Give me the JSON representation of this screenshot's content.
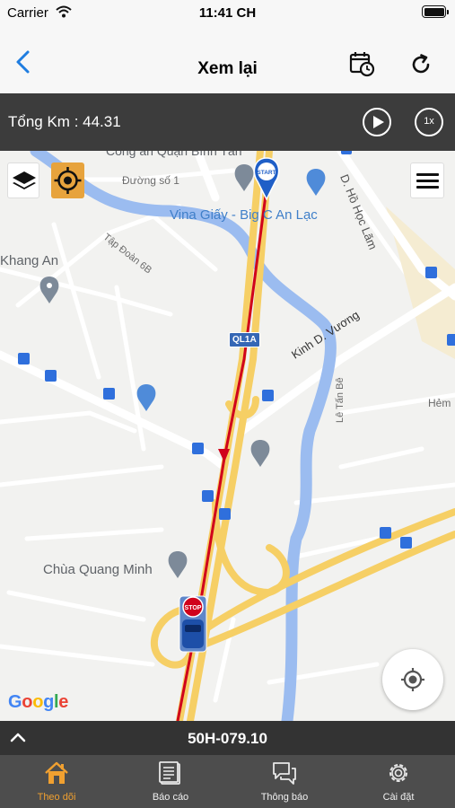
{
  "status_bar": {
    "carrier": "Carrier",
    "time": "11:41 CH"
  },
  "nav": {
    "title": "Xem lại"
  },
  "info": {
    "total_km": "Tổng Km : 44.31",
    "speed": "1x"
  },
  "map": {
    "labels": {
      "khang_an": "Khang An",
      "vina_giay": "Vina Giấy - Big C An Lạc",
      "duong_so_1": "Đường số 1",
      "cong_an": "Công an Quận Bình Tân",
      "tap_doan": "Tập Đoàn 6B",
      "kinh_d_vuong": "Kinh D. Vương",
      "d_ho_hoc_lam": "D. Hồ Học Lãm",
      "le_tan_be": "Lê Tấn Bê",
      "hem": "Hẻm",
      "chua_quang_minh": "Chùa Quang Minh",
      "ql1a": "QL1A",
      "start": "START",
      "stop": "STOP"
    },
    "google": [
      "G",
      "o",
      "o",
      "g",
      "l",
      "e"
    ]
  },
  "vehicle": {
    "plate": "50H-079.10"
  },
  "tabs": [
    {
      "label": "Theo dõi",
      "icon": "home-icon",
      "active": true
    },
    {
      "label": "Báo cáo",
      "icon": "report-icon",
      "active": false
    },
    {
      "label": "Thông báo",
      "icon": "chat-icon",
      "active": false
    },
    {
      "label": "Cài đặt",
      "icon": "gear-icon",
      "active": false
    }
  ],
  "colors": {
    "accent_blue": "#1f7de0",
    "route_red": "#d0021b",
    "highway": "#f6cf65",
    "river": "#9bbcf0",
    "active_tab": "#f0a030",
    "locate_button": "#e7a33d"
  }
}
